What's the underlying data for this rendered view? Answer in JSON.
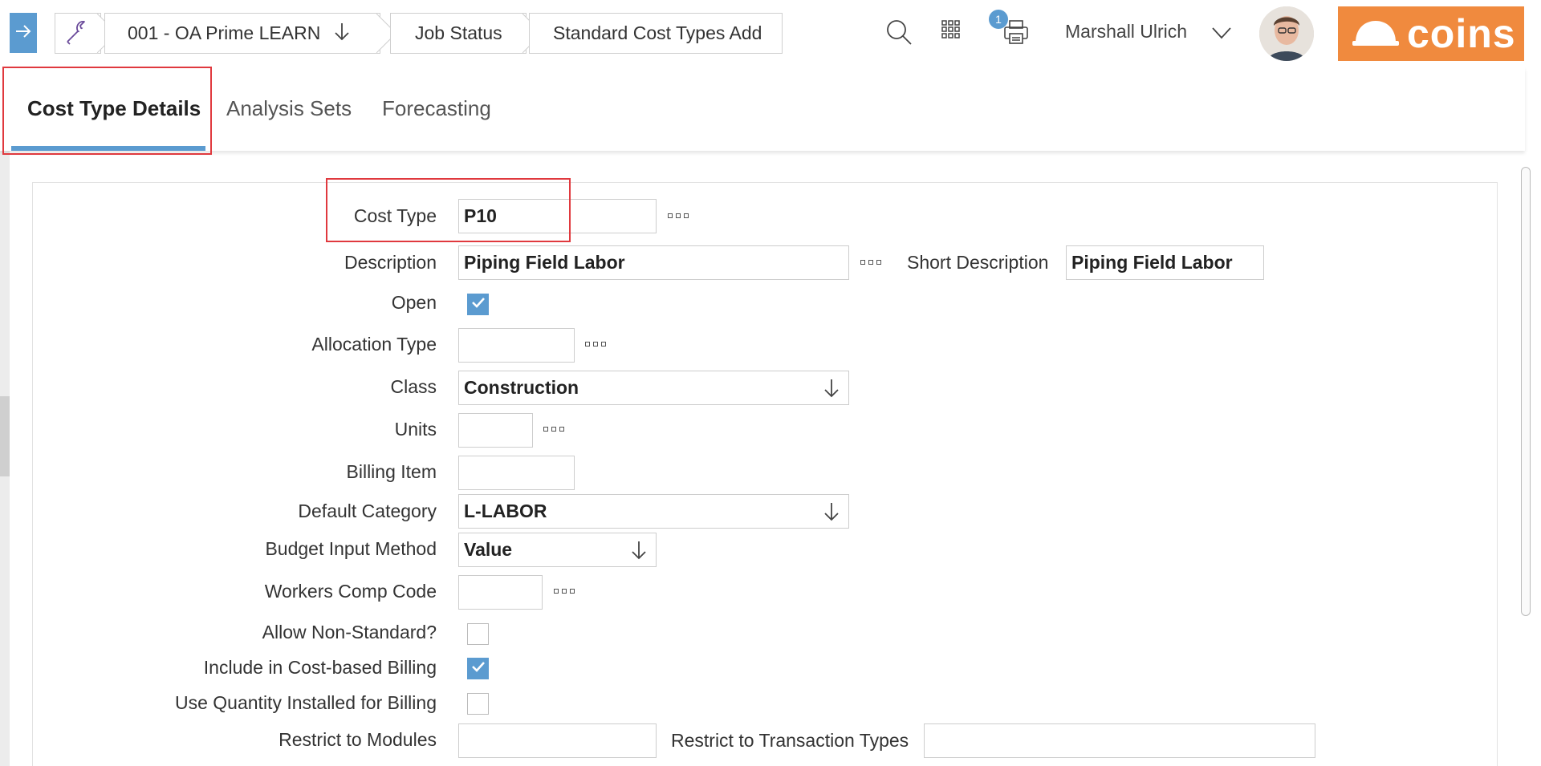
{
  "breadcrumbs": {
    "company": "001 - OA Prime LEARN",
    "status": "Job Status",
    "page": "Standard Cost Types Add"
  },
  "header": {
    "print_badge": "1",
    "user_name": "Marshall Ulrich",
    "logo_text": "coins"
  },
  "tabs": [
    {
      "label": "Cost Type Details",
      "active": true
    },
    {
      "label": "Analysis Sets",
      "active": false
    },
    {
      "label": "Forecasting",
      "active": false
    }
  ],
  "form": {
    "cost_type": {
      "label": "Cost Type",
      "value": "P10"
    },
    "description": {
      "label": "Description",
      "value": "Piping Field Labor"
    },
    "short_description": {
      "label": "Short Description",
      "value": "Piping Field Labor"
    },
    "open": {
      "label": "Open",
      "checked": true
    },
    "allocation_type": {
      "label": "Allocation Type",
      "value": ""
    },
    "class": {
      "label": "Class",
      "value": "Construction"
    },
    "units": {
      "label": "Units",
      "value": ""
    },
    "billing_item": {
      "label": "Billing Item",
      "value": ""
    },
    "default_category": {
      "label": "Default Category",
      "value": "L-LABOR"
    },
    "budget_input_method": {
      "label": "Budget Input Method",
      "value": "Value"
    },
    "workers_comp_code": {
      "label": "Workers Comp Code",
      "value": ""
    },
    "allow_non_standard": {
      "label": "Allow Non-Standard?",
      "checked": false
    },
    "include_cost_billing": {
      "label": "Include in Cost-based Billing",
      "checked": true
    },
    "use_qty_installed": {
      "label": "Use Quantity Installed for Billing",
      "checked": false
    },
    "restrict_modules": {
      "label": "Restrict to Modules",
      "value": ""
    },
    "restrict_transaction_types": {
      "label": "Restrict to Transaction Types",
      "value": ""
    }
  },
  "colors": {
    "accent": "#5b9bd0",
    "logo": "#f08a3e",
    "highlight": "#e0393e"
  }
}
